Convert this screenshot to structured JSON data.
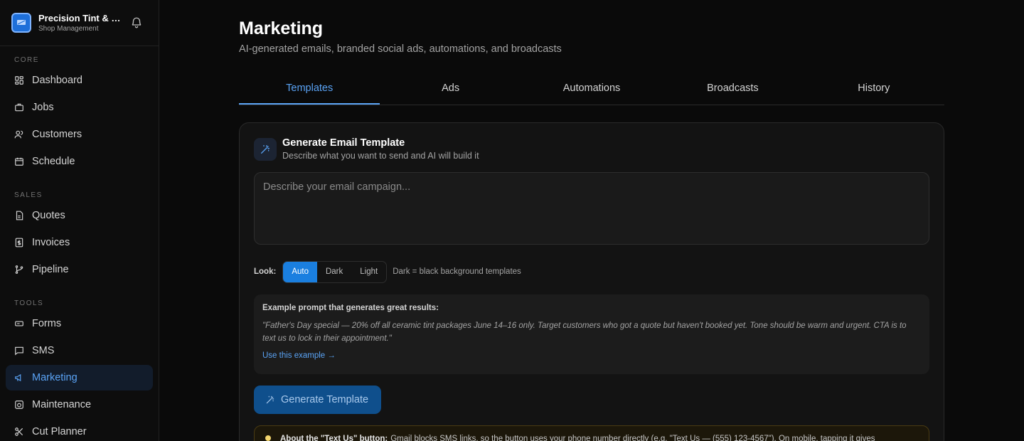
{
  "brand": {
    "name": "Precision Tint & Wrap",
    "subtitle": "Shop Management",
    "accent": "#1e6fd9"
  },
  "sidebar": {
    "sections": [
      {
        "label": "CORE",
        "items": [
          {
            "label": "Dashboard",
            "icon": "grid-icon"
          },
          {
            "label": "Jobs",
            "icon": "briefcase-icon"
          },
          {
            "label": "Customers",
            "icon": "users-icon"
          },
          {
            "label": "Schedule",
            "icon": "calendar-icon"
          }
        ]
      },
      {
        "label": "SALES",
        "items": [
          {
            "label": "Quotes",
            "icon": "document-icon"
          },
          {
            "label": "Invoices",
            "icon": "receipt-icon"
          },
          {
            "label": "Pipeline",
            "icon": "git-branch-icon"
          }
        ]
      },
      {
        "label": "TOOLS",
        "items": [
          {
            "label": "Forms",
            "icon": "form-icon"
          },
          {
            "label": "SMS",
            "icon": "message-icon"
          },
          {
            "label": "Marketing",
            "icon": "megaphone-icon",
            "active": true
          },
          {
            "label": "Maintenance",
            "icon": "maintenance-icon"
          },
          {
            "label": "Cut Planner",
            "icon": "scissors-icon"
          }
        ]
      }
    ]
  },
  "page": {
    "title": "Marketing",
    "subtitle": "AI-generated emails, branded social ads, automations, and broadcasts"
  },
  "tabs": [
    {
      "label": "Templates",
      "active": true
    },
    {
      "label": "Ads"
    },
    {
      "label": "Automations"
    },
    {
      "label": "Broadcasts"
    },
    {
      "label": "History"
    }
  ],
  "generator": {
    "title": "Generate Email Template",
    "subtitle": "Describe what you want to send and AI will build it",
    "placeholder": "Describe your email campaign...",
    "look_label": "Look:",
    "look_options": [
      "Auto",
      "Dark",
      "Light"
    ],
    "look_selected": "Auto",
    "look_hint": "Dark = black background templates",
    "example_title": "Example prompt that generates great results:",
    "example_body": "\"Father's Day special — 20% off all ceramic tint packages June 14–16 only. Target customers who got a quote but haven't booked yet. Tone should be warm and urgent. CTA is to text us to lock in their appointment.\"",
    "example_link": "Use this example →",
    "button_label": "Generate Template",
    "note_bold": "About the \"Text Us\" button:",
    "note_text": "Gmail blocks SMS links, so the button uses your phone number directly (e.g. \"Text Us — (555) 123-4567\"). On mobile, tapping it gives"
  },
  "colors": {
    "active": "#5aa3f5",
    "primary_button": "#1a7fe0"
  }
}
